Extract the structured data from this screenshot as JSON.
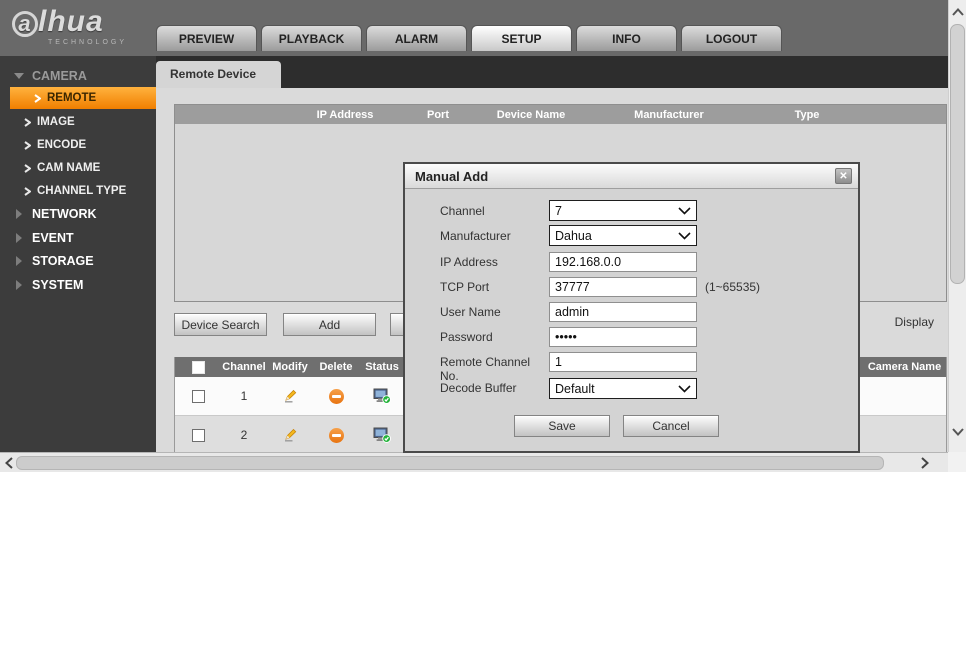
{
  "colors": {
    "accent_orange": "#f07f00",
    "header_gray": "#696969",
    "sidebar_dark": "#3c3c3c"
  },
  "header": {
    "logo_text": "a",
    "logo_rest": "lhua",
    "logo_sub": "TECHNOLOGY",
    "nav": [
      {
        "label": "PREVIEW"
      },
      {
        "label": "PLAYBACK"
      },
      {
        "label": "ALARM"
      },
      {
        "label": "SETUP"
      },
      {
        "label": "INFO"
      },
      {
        "label": "LOGOUT"
      }
    ]
  },
  "sidebar": {
    "camera": "CAMERA",
    "camera_children": [
      "REMOTE",
      "IMAGE",
      "ENCODE",
      "CAM NAME",
      "CHANNEL TYPE"
    ],
    "groups": [
      "NETWORK",
      "EVENT",
      "STORAGE",
      "SYSTEM"
    ]
  },
  "main": {
    "tab_label": "Remote Device",
    "search_table_columns": [
      "IP Address",
      "Port",
      "Device Name",
      "Manufacturer",
      "Type"
    ],
    "device_search_label": "Device Search",
    "add_label": "Add",
    "display_label": "Display",
    "device_table": {
      "columns": [
        "Channel",
        "Modify",
        "Delete",
        "Status"
      ],
      "camera_name_col": "Camera Name",
      "rows": [
        {
          "channel": "1"
        },
        {
          "channel": "2"
        }
      ]
    }
  },
  "dialog": {
    "title": "Manual Add",
    "close_glyph": "✕",
    "fields": [
      {
        "label": "Channel",
        "value": "7"
      },
      {
        "label": "Manufacturer",
        "value": "Dahua"
      },
      {
        "label": "IP Address",
        "value": "192.168.0.0"
      },
      {
        "label": "TCP Port",
        "value": "37777",
        "hint": "(1~65535)"
      },
      {
        "label": "User Name",
        "value": "admin"
      },
      {
        "label": "Password",
        "value": "•••••"
      },
      {
        "label": "Remote Channel No.",
        "value": "1"
      },
      {
        "label": "Decode Buffer",
        "value": "Default"
      }
    ],
    "save_label": "Save",
    "cancel_label": "Cancel"
  }
}
